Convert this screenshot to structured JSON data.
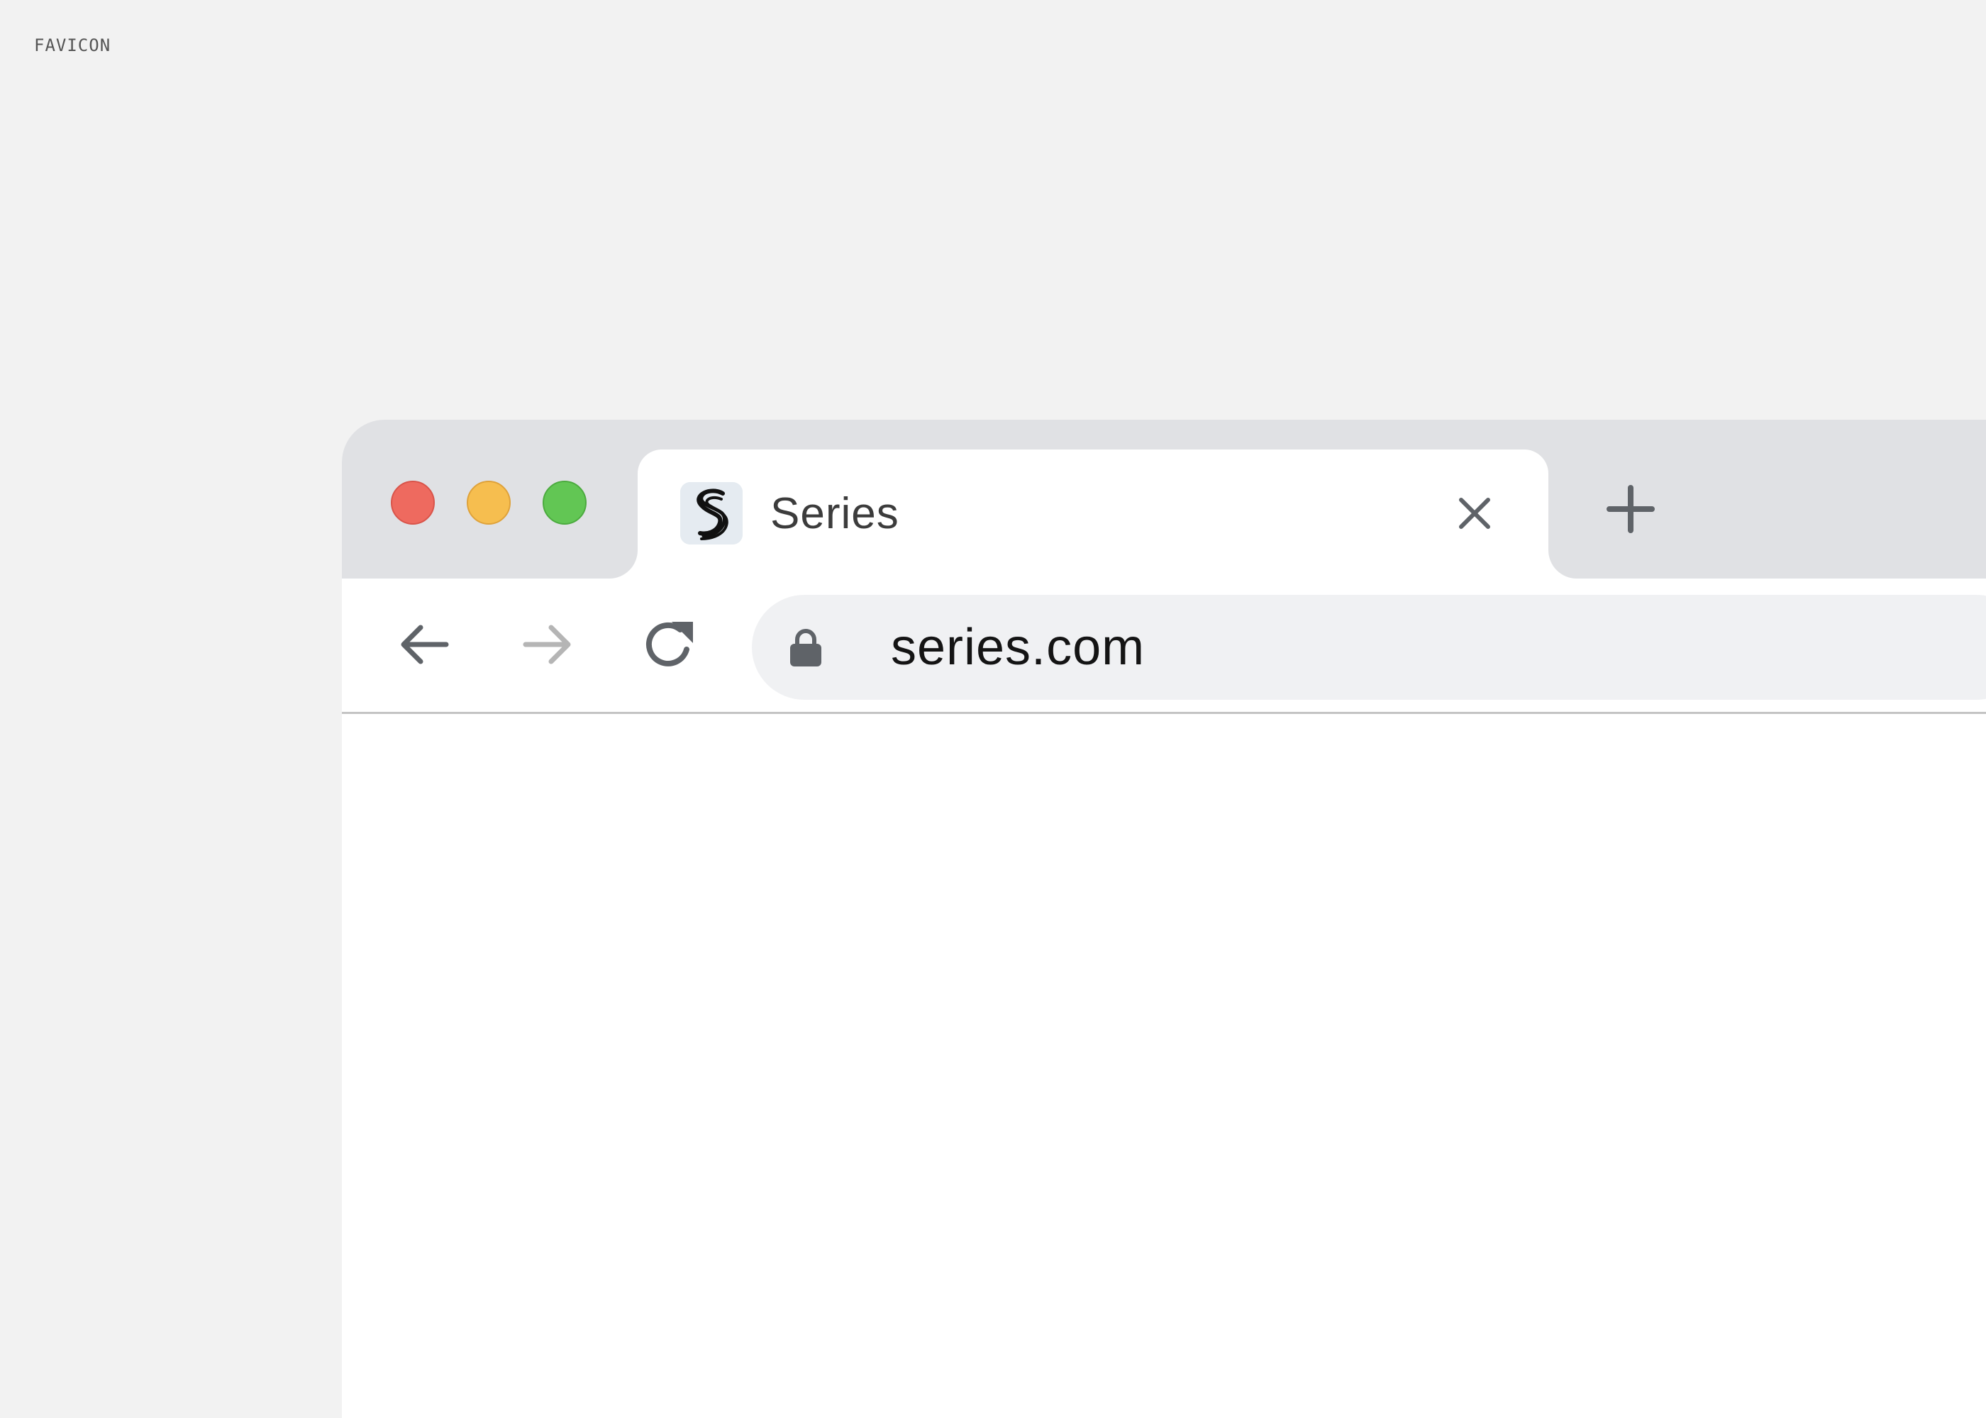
{
  "caption": "FAVICON",
  "window": {
    "traffic_lights": {
      "close_color": "#ee6a5f",
      "minimize_color": "#f6be4f",
      "maximize_color": "#62c654"
    },
    "tabs": [
      {
        "title": "Series",
        "favicon": "series-logo-icon",
        "active": true,
        "close_icon": "close-icon"
      }
    ],
    "new_tab_icon": "plus-icon"
  },
  "toolbar": {
    "back_icon": "arrow-left-icon",
    "forward_icon": "arrow-right-icon",
    "forward_enabled": false,
    "reload_icon": "reload-icon",
    "security_icon": "lock-icon",
    "url": "series.com"
  },
  "colors": {
    "page_background": "#f2f2f2",
    "tabstrip_background": "#e0e1e4",
    "omnibox_background": "#f0f1f3",
    "icon_color": "#5f6368",
    "disabled_icon_color": "#b5b5b5"
  }
}
